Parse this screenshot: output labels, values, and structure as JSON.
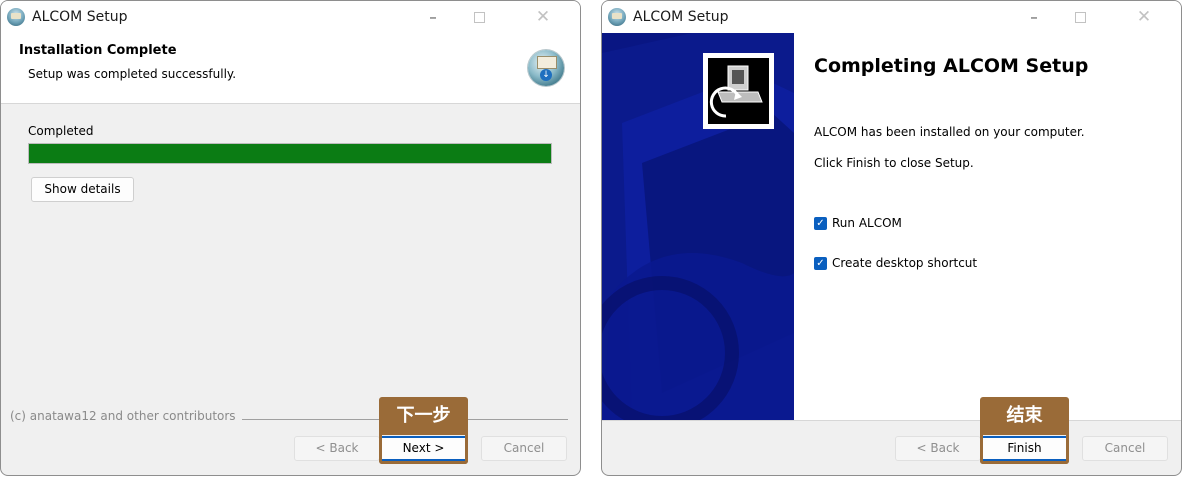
{
  "window1": {
    "title": "ALCOM Setup",
    "controls": {
      "minimize": "–",
      "close": "✕"
    },
    "header_title": "Installation Complete",
    "header_subtitle": "Setup was completed successfully.",
    "progress_label": "Completed",
    "progress_value": 1.0,
    "progress_color": "#0b7c14",
    "show_details_label": "Show details",
    "copyright": "(c) anatawa12 and other contributors",
    "back_label": "< Back",
    "next_label": "Next >",
    "cancel_label": "Cancel",
    "annotation_tag": "下一步"
  },
  "window2": {
    "title": "ALCOM Setup",
    "controls": {
      "minimize": "–",
      "close": "✕"
    },
    "heading": "Completing ALCOM Setup",
    "para1": "ALCOM has been installed on your computer.",
    "para2": "Click Finish to close Setup.",
    "checkbox_run": {
      "label": "Run ALCOM",
      "checked": true
    },
    "checkbox_shortcut": {
      "label": "Create desktop shortcut",
      "checked": true
    },
    "back_label": "< Back",
    "finish_label": "Finish",
    "cancel_label": "Cancel",
    "annotation_tag": "结束",
    "sidebar_color": "#0b1a8c"
  },
  "colors": {
    "accent": "#0a5fbf",
    "annotation": "#9a6b38"
  }
}
